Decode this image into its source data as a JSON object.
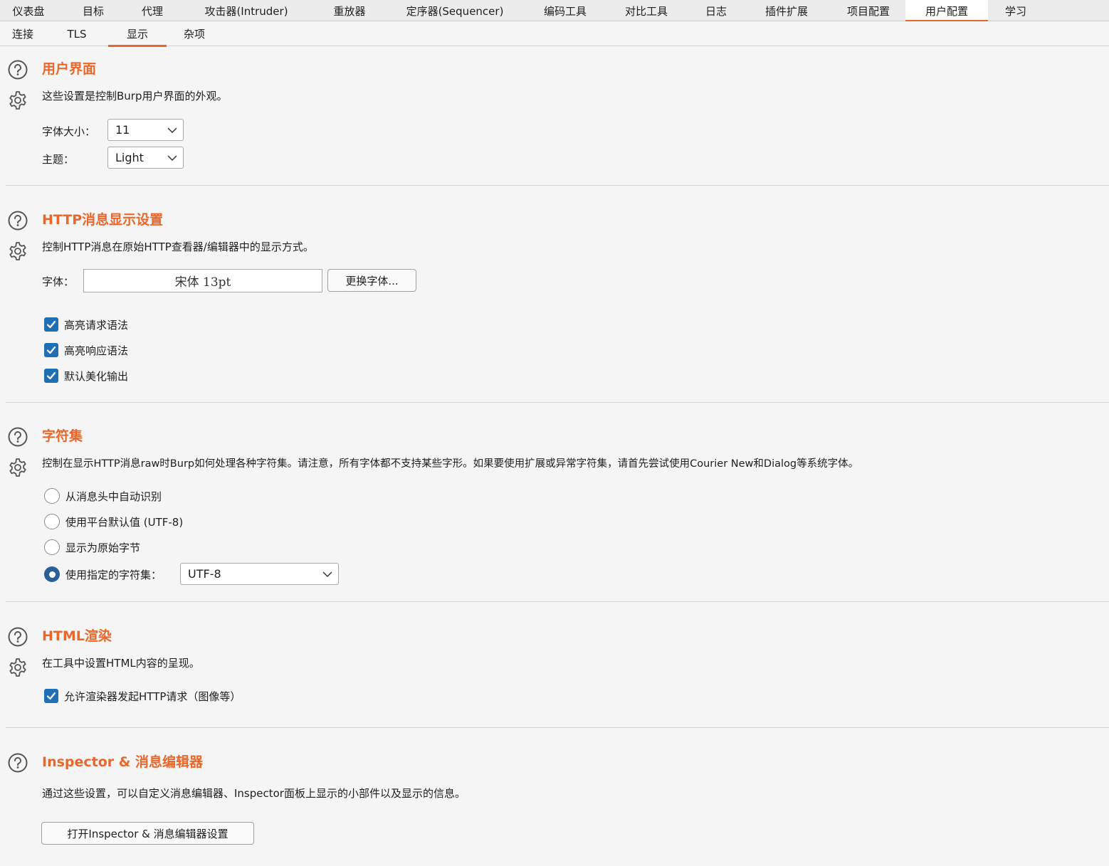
{
  "top_tabs": [
    "仪表盘",
    "目标",
    "代理",
    "攻击器(Intruder)",
    "重放器",
    "定序器(Sequencer)",
    "编码工具",
    "对比工具",
    "日志",
    "插件扩展",
    "项目配置",
    "用户配置",
    "学习"
  ],
  "top_tab_active": "用户配置",
  "sub_tabs": [
    "连接",
    "TLS",
    "显示",
    "杂项"
  ],
  "sub_tab_active": "显示",
  "ui": {
    "title": "用户界面",
    "desc": "这些设置是控制Burp用户界面的外观。",
    "font_size_label": "字体大小：",
    "font_size_value": "11",
    "theme_label": "主题：",
    "theme_value": "Light"
  },
  "http": {
    "title": "HTTP消息显示设置",
    "desc": "控制HTTP消息在原始HTTP查看器/编辑器中的显示方式。",
    "font_label": "字体：",
    "font_value": "宋体 13pt",
    "change_font_button": "更换字体...",
    "checks": [
      {
        "label": "高亮请求语法",
        "checked": true
      },
      {
        "label": "高亮响应语法",
        "checked": true
      },
      {
        "label": "默认美化输出",
        "checked": true
      }
    ]
  },
  "charset": {
    "title": "字符集",
    "desc": "控制在显示HTTP消息raw时Burp如何处理各种字符集。请注意，所有字体都不支持某些字形。如果要使用扩展或异常字符集，请首先尝试使用Courier New和Dialog等系统字体。",
    "options": [
      {
        "label": "从消息头中自动识别",
        "selected": false
      },
      {
        "label": "使用平台默认值 (UTF-8)",
        "selected": false
      },
      {
        "label": "显示为原始字节",
        "selected": false
      },
      {
        "label": "使用指定的字符集：",
        "selected": true
      }
    ],
    "charset_value": "UTF-8"
  },
  "html": {
    "title": "HTML渲染",
    "desc": "在工具中设置HTML内容的呈现。",
    "check_label": "允许渲染器发起HTTP请求（图像等）",
    "checked": true
  },
  "inspector": {
    "title": "Inspector & 消息编辑器",
    "desc": "通过这些设置，可以自定义消息编辑器、Inspector面板上显示的小部件以及显示的信息。",
    "button": "打开Inspector & 消息编辑器设置"
  },
  "colors": {
    "accent": "#e8682c",
    "checkbox": "#1f6fb5"
  }
}
